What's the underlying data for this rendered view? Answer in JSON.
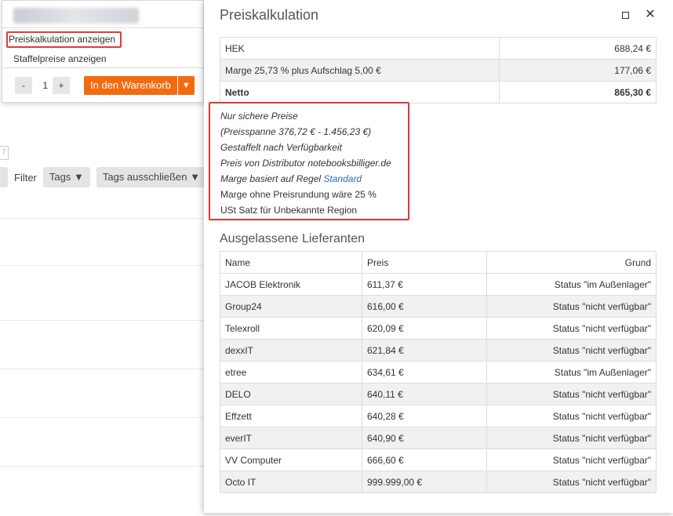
{
  "background": {
    "filter_label": "Filter",
    "tags_label": "Tags ▼",
    "tags_exclude_label": "Tags ausschließen ▼",
    "number_stub": "7"
  },
  "menu": {
    "item_price_calc": "Preiskalkulation anzeigen",
    "item_tier_prices": "Staffelpreise anzeigen",
    "qty_minus": "-",
    "qty_value": "1",
    "qty_plus": "+",
    "cart_button": "In den Warenkorb",
    "cart_caret": "▼"
  },
  "panel": {
    "title": "Preiskalkulation",
    "close_glyph": "✕",
    "calc_rows": [
      {
        "label": "HEK",
        "value": "688,24 €"
      },
      {
        "label": "Marge 25,73 % plus Aufschlag 5,00 €",
        "value": "177,06 €"
      },
      {
        "label": "Netto",
        "value": "865,30 €"
      }
    ],
    "notes": {
      "n1": "Nur sichere Preise",
      "n2": "(Preisspanne 376,72 € - 1.456,23 €)",
      "n3": "Gestaffelt nach Verfügbarkeit",
      "n4": "Preis von Distributor notebooksbilliger.de",
      "n5_prefix": "Marge basiert auf Regel ",
      "n5_link": "Standard",
      "n6": "Marge ohne Preisrundung wäre 25 %",
      "n7": "USt Satz für Unbekannte Region"
    },
    "skipped_title": "Ausgelassene Lieferanten",
    "skipped_headers": {
      "name": "Name",
      "price": "Preis",
      "reason": "Grund"
    },
    "skipped_rows": [
      {
        "name": "JACOB Elektronik",
        "price": "611,37 €",
        "reason": "Status \"im Außenlager\""
      },
      {
        "name": "Group24",
        "price": "616,00 €",
        "reason": "Status \"nicht verfügbar\""
      },
      {
        "name": "Telexroll",
        "price": "620,09 €",
        "reason": "Status \"nicht verfügbar\""
      },
      {
        "name": "dexxIT",
        "price": "621,84 €",
        "reason": "Status \"nicht verfügbar\""
      },
      {
        "name": "etree",
        "price": "634,61 €",
        "reason": "Status \"im Außenlager\""
      },
      {
        "name": "DELO",
        "price": "640,11 €",
        "reason": "Status \"nicht verfügbar\""
      },
      {
        "name": "Effzett",
        "price": "640,28 €",
        "reason": "Status \"nicht verfügbar\""
      },
      {
        "name": "everIT",
        "price": "640,90 €",
        "reason": "Status \"nicht verfügbar\""
      },
      {
        "name": "VV Computer",
        "price": "666,60 €",
        "reason": "Status \"nicht verfügbar\""
      },
      {
        "name": "Octo IT",
        "price": "999.999,00 €",
        "reason": "Status \"nicht verfügbar\""
      }
    ]
  },
  "colors": {
    "accent_orange": "#f26b0f",
    "highlight_red": "#e03a3a",
    "link_blue": "#2a6ebb"
  }
}
